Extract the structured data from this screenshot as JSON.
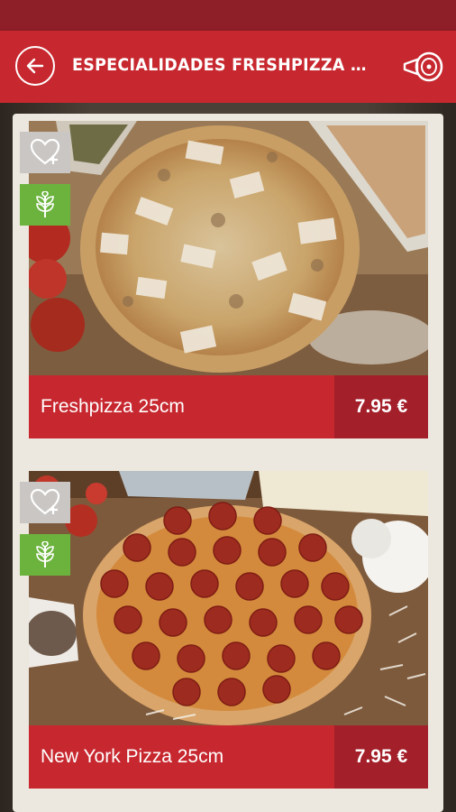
{
  "header": {
    "title": "ESPECIALIDADES FRESHPIZZA PEQU...",
    "back_icon": "arrow-left-circle-icon",
    "menu_icon": "ham-leg-icon"
  },
  "colors": {
    "primary": "#c7282f",
    "status_bar": "#8e1e27",
    "price_block": "#a31f29",
    "veg_badge": "#6cb33e",
    "fav_badge": "#c9c6c4",
    "panel": "#ece8df"
  },
  "products": [
    {
      "name": "Freshpizza 25cm",
      "price": "7.95 €",
      "image": "pizza-chicken-photo"
    },
    {
      "name": "New York Pizza 25cm",
      "price": "7.95 €",
      "image": "pizza-pepperoni-photo"
    }
  ]
}
